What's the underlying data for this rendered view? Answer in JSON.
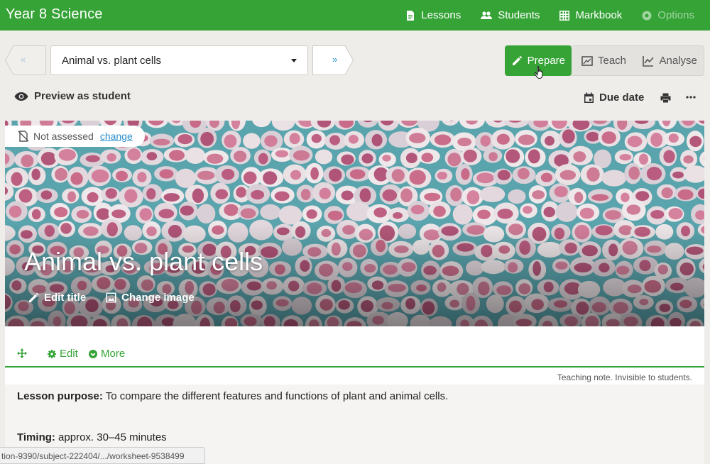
{
  "app": {
    "title": "Year 8 Science"
  },
  "nav": {
    "lessons": "Lessons",
    "students": "Students",
    "markbook": "Markbook",
    "options": "Options"
  },
  "lesson_nav": {
    "prev": "«",
    "next": "»",
    "selected_lesson": "Animal vs. plant cells"
  },
  "modes": {
    "prepare": "Prepare",
    "teach": "Teach",
    "analyse": "Analyse",
    "active": "prepare"
  },
  "toolbar": {
    "preview": "Preview as student",
    "due_date": "Due date"
  },
  "hero": {
    "assessment_status": "Not assessed",
    "assessment_change": "change",
    "title": "Animal vs. plant cells",
    "edit_title": "Edit title",
    "change_image": "Change image"
  },
  "card": {
    "edit": "Edit",
    "more": "More",
    "note_caption": "Teaching note. Invisible to students.",
    "purpose_label": "Lesson purpose:",
    "purpose_text": " To compare the different features and functions of plant and animal cells.",
    "timing_label": "Timing:",
    "timing_text": " approx. 30–45 minutes"
  },
  "status_bar": {
    "url": "tion-9390/subject-222404/.../worksheet-9538499"
  },
  "colors": {
    "brand_green": "#36a337",
    "link_blue": "#2a8ecf",
    "background": "#efedea"
  },
  "icons": {
    "lessons": "document-icon",
    "students": "people-icon",
    "markbook": "grid-icon",
    "options": "gear-icon",
    "prepare": "pencil-icon",
    "teach": "presentation-icon",
    "analyse": "line-chart-icon",
    "preview": "eye-icon",
    "due_date": "calendar-icon",
    "print": "printer-icon",
    "more": "ellipsis-icon",
    "not_assessed": "no-assessment-icon",
    "edit_title": "pencil-icon",
    "change_image": "image-icon",
    "move": "move-arrows-icon",
    "edit": "gear-icon",
    "more_card": "chevron-circle-icon"
  }
}
